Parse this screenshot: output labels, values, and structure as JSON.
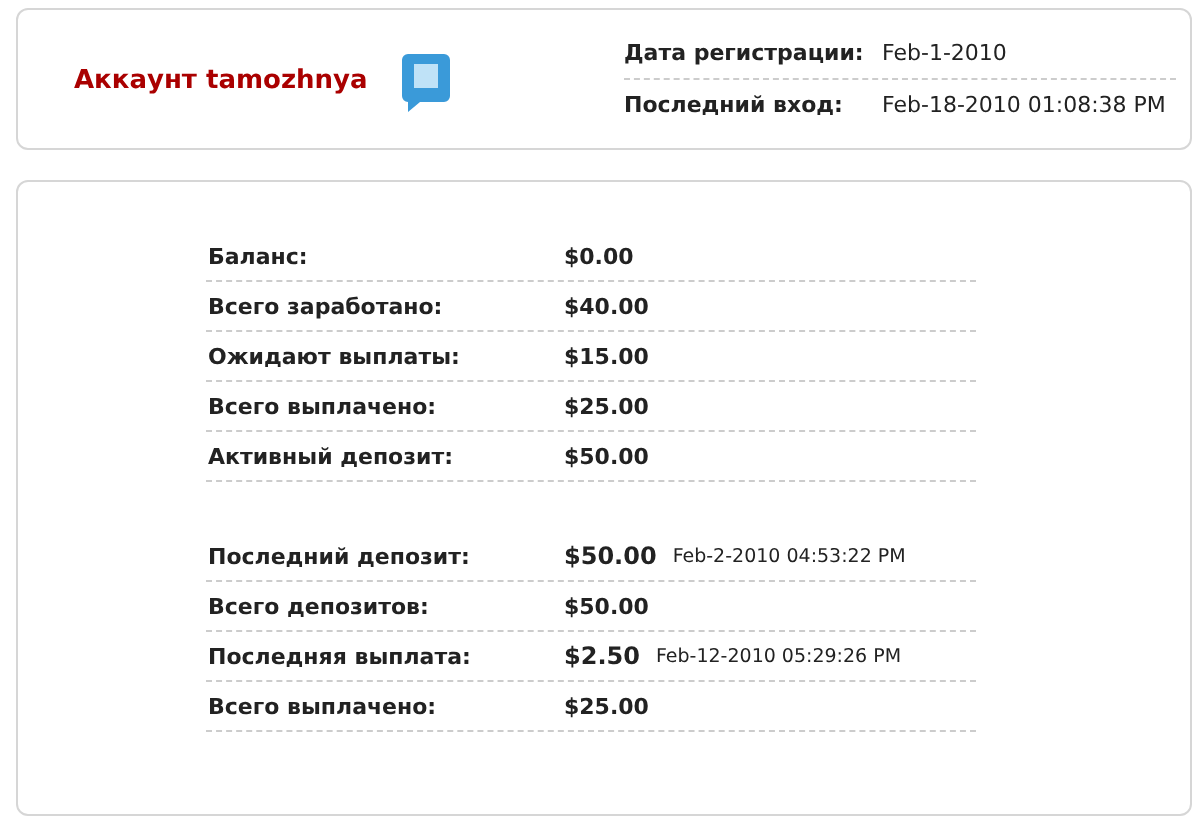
{
  "account": {
    "title": "Аккаунт tamozhnya"
  },
  "info": [
    {
      "label": "Дата регистрации:",
      "value": "Feb-1-2010"
    },
    {
      "label": "Последний вход:",
      "value": "Feb-18-2010 01:08:38 PM"
    }
  ],
  "groups": [
    [
      {
        "label": "Баланс:",
        "value": "$0.00"
      },
      {
        "label": "Всего заработано:",
        "value": "$40.00"
      },
      {
        "label": "Ожидают выплаты:",
        "value": "$15.00"
      },
      {
        "label": "Всего выплачено:",
        "value": "$25.00"
      },
      {
        "label": "Активный депозит:",
        "value": "$50.00"
      }
    ],
    [
      {
        "label": "Последний депозит:",
        "value": "$50.00",
        "date": "Feb-2-2010 04:53:22 PM"
      },
      {
        "label": "Всего депозитов:",
        "value": "$50.00"
      },
      {
        "label": "Последняя выплата:",
        "value": "$2.50",
        "date": "Feb-12-2010 05:29:26 PM"
      },
      {
        "label": "Всего выплачено:",
        "value": "$25.00"
      }
    ]
  ]
}
